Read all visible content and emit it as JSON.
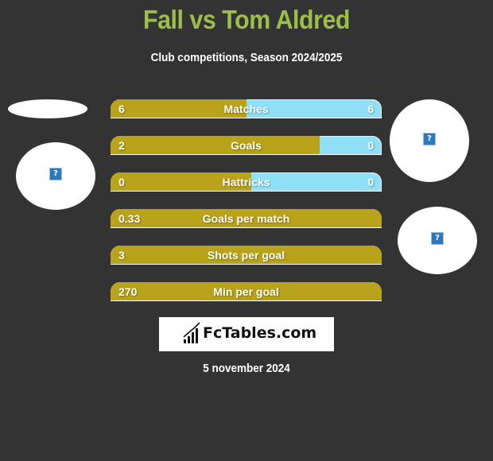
{
  "header": {
    "title": "Fall vs Tom Aldred",
    "subtitle": "Club competitions, Season 2024/2025"
  },
  "colors": {
    "background": "#333333",
    "title": "#9dbf4a",
    "left_bar": "#b9a31b",
    "right_bar": "#8fe0f6"
  },
  "players": {
    "left": {
      "image_icon": "broken-image-icon"
    },
    "right": {
      "image_icon": "broken-image-icon"
    },
    "right_club": {
      "image_icon": "broken-image-icon"
    }
  },
  "stats": [
    {
      "label": "Matches",
      "left": "6",
      "right": "6",
      "left_share": 0.5
    },
    {
      "label": "Goals",
      "left": "2",
      "right": "0",
      "left_share": 0.77
    },
    {
      "label": "Hattricks",
      "left": "0",
      "right": "0",
      "left_share": 0.52
    },
    {
      "label": "Goals per match",
      "left": "0.33",
      "right": "",
      "left_share": 1.0
    },
    {
      "label": "Shots per goal",
      "left": "3",
      "right": "",
      "left_share": 1.0
    },
    {
      "label": "Min per goal",
      "left": "270",
      "right": "",
      "left_share": 1.0
    }
  ],
  "branding": {
    "logo_text": "FcTables.com"
  },
  "footer": {
    "date": "5 november 2024"
  }
}
